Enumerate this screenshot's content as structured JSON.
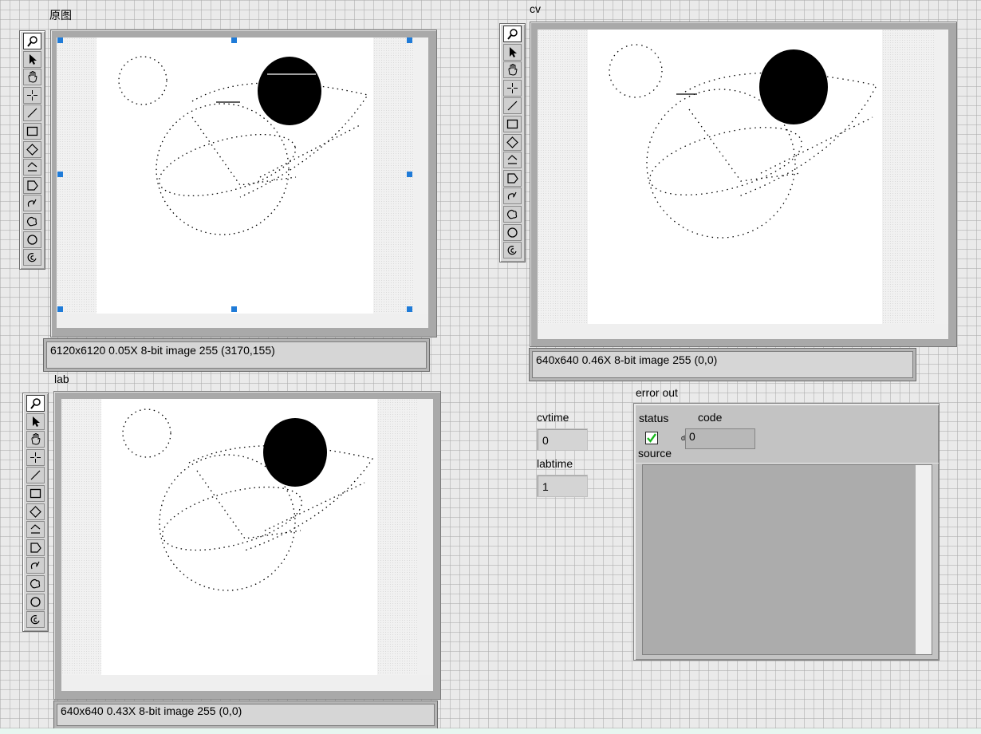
{
  "panels": {
    "original": {
      "label": "原图",
      "status": "6120x6120 0.05X 8-bit image 255     (3170,155)"
    },
    "cv": {
      "label": "cv",
      "status": "640x640 0.46X 8-bit image 255     (0,0)"
    },
    "lab": {
      "label": "lab",
      "status": "640x640 0.43X 8-bit image 255     (0,0)"
    }
  },
  "tools": [
    "zoom-icon",
    "arrow-icon",
    "pan-hand-icon",
    "crosshair-icon",
    "line-icon",
    "rectangle-icon",
    "rotated-rectangle-icon",
    "polyline-icon",
    "polygon-icon",
    "freehand-line-icon",
    "freehand-region-icon",
    "oval-icon",
    "annulus-icon"
  ],
  "indicators": {
    "cvtime": {
      "label": "cvtime",
      "value": "0"
    },
    "labtime": {
      "label": "labtime",
      "value": "1"
    }
  },
  "error_out": {
    "title": "error out",
    "status_label": "status",
    "code_label": "code",
    "code_prefix": "d",
    "code_value": "0",
    "source_label": "source",
    "status_checked": true
  }
}
